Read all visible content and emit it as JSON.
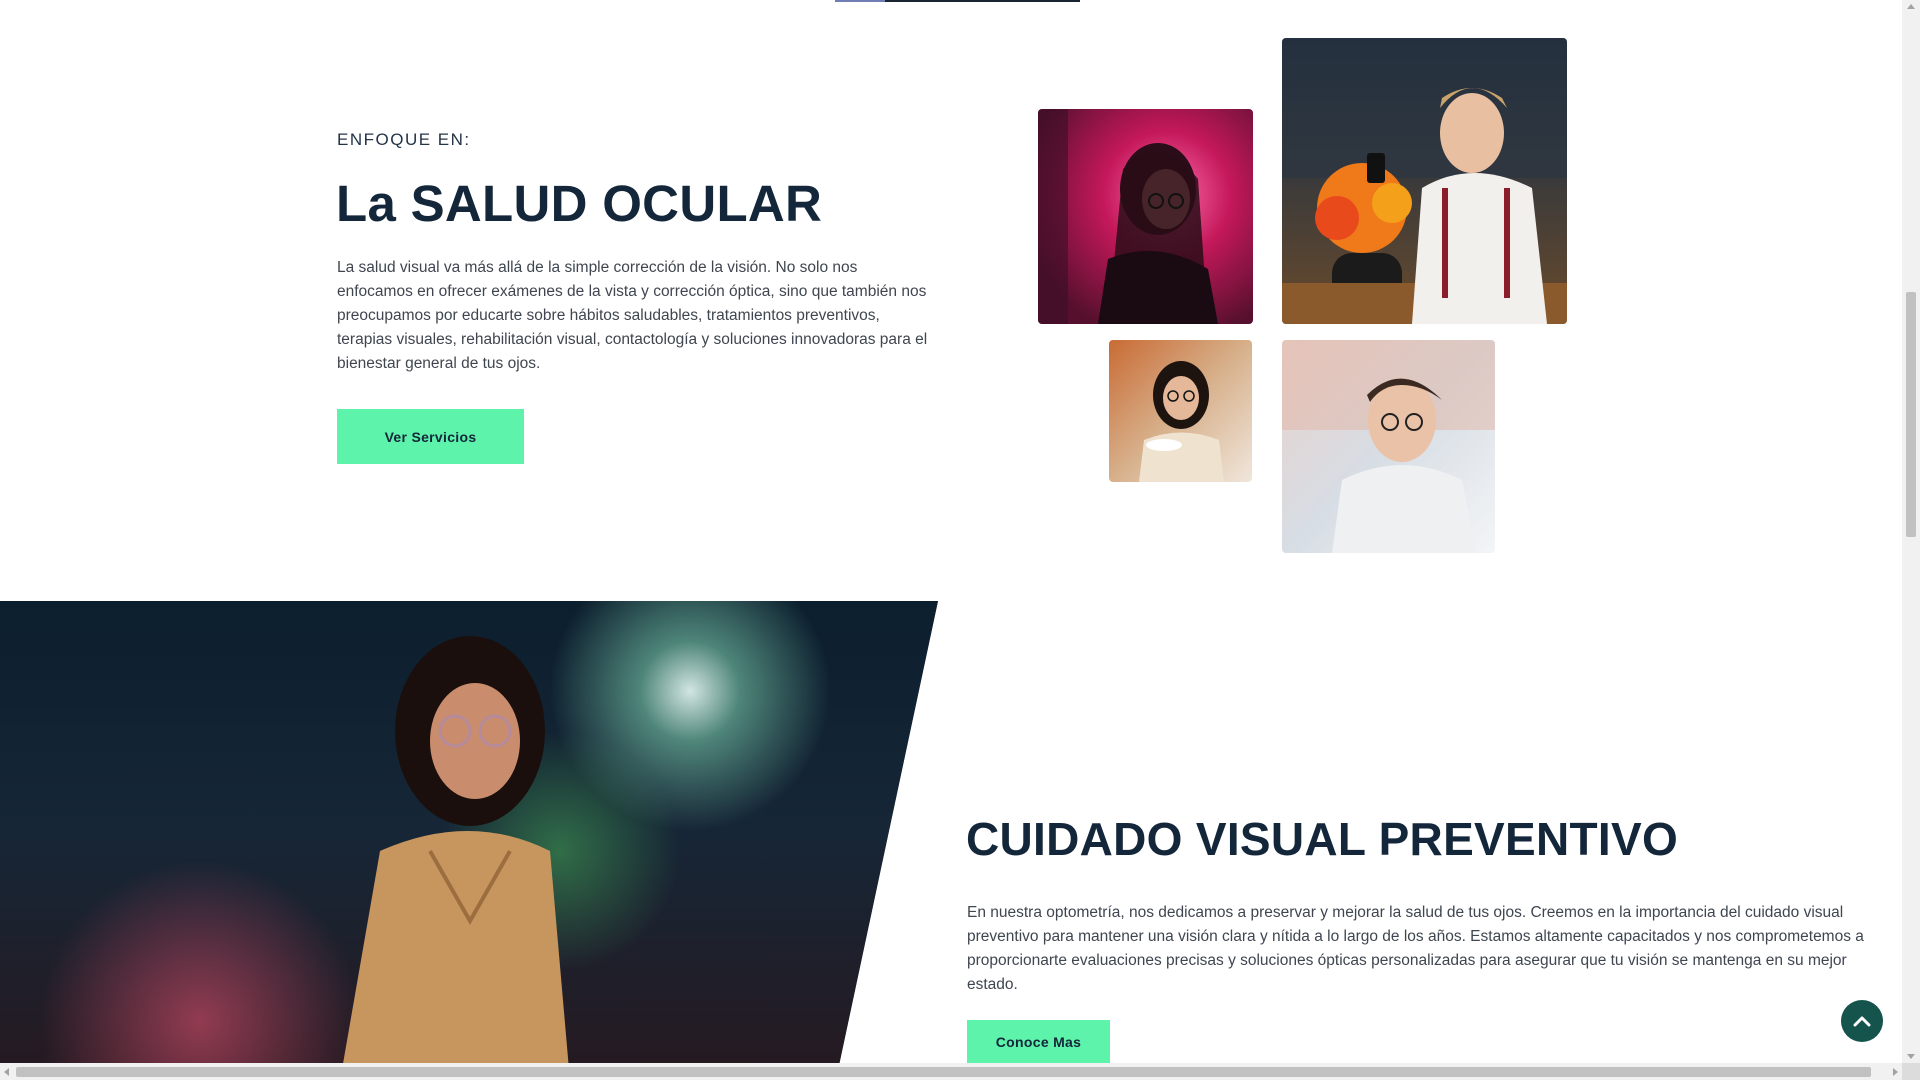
{
  "focus_section": {
    "eyebrow": "ENFOQUE EN:",
    "title": "La SALUD OCULAR",
    "description": "La salud visual va más allá de la simple corrección de la visión. No solo nos enfocamos en ofrecer exámenes de la vista y corrección óptica, sino que también nos preocupamos por educarte sobre hábitos saludables, tratamientos preventivos, terapias visuales, rehabilitación visual, contactología y soluciones innovadoras para el bienestar general de tus ojos.",
    "button_label": "Ver Servicios"
  },
  "preventive_section": {
    "title": "CUIDADO VISUAL PREVENTIVO",
    "description": "En nuestra optometría, nos dedicamos a preservar y mejorar la salud de tus ojos. Creemos en la importancia del cuidado visual preventivo para mantener una visión clara y nítida a lo largo de los años. Estamos altamente capacitados y nos comprometemos a proporcionarte evaluaciones precisas y soluciones ópticas personalizadas para asegurar que tu visión se mantenga en su mejor estado.",
    "button_label": "Conoce Mas"
  },
  "colors": {
    "accent": "#5ef3ab",
    "heading": "#13263a",
    "scroll_top_button": "#14544d"
  },
  "icons": {
    "scroll_top": "chevron-up-icon"
  }
}
